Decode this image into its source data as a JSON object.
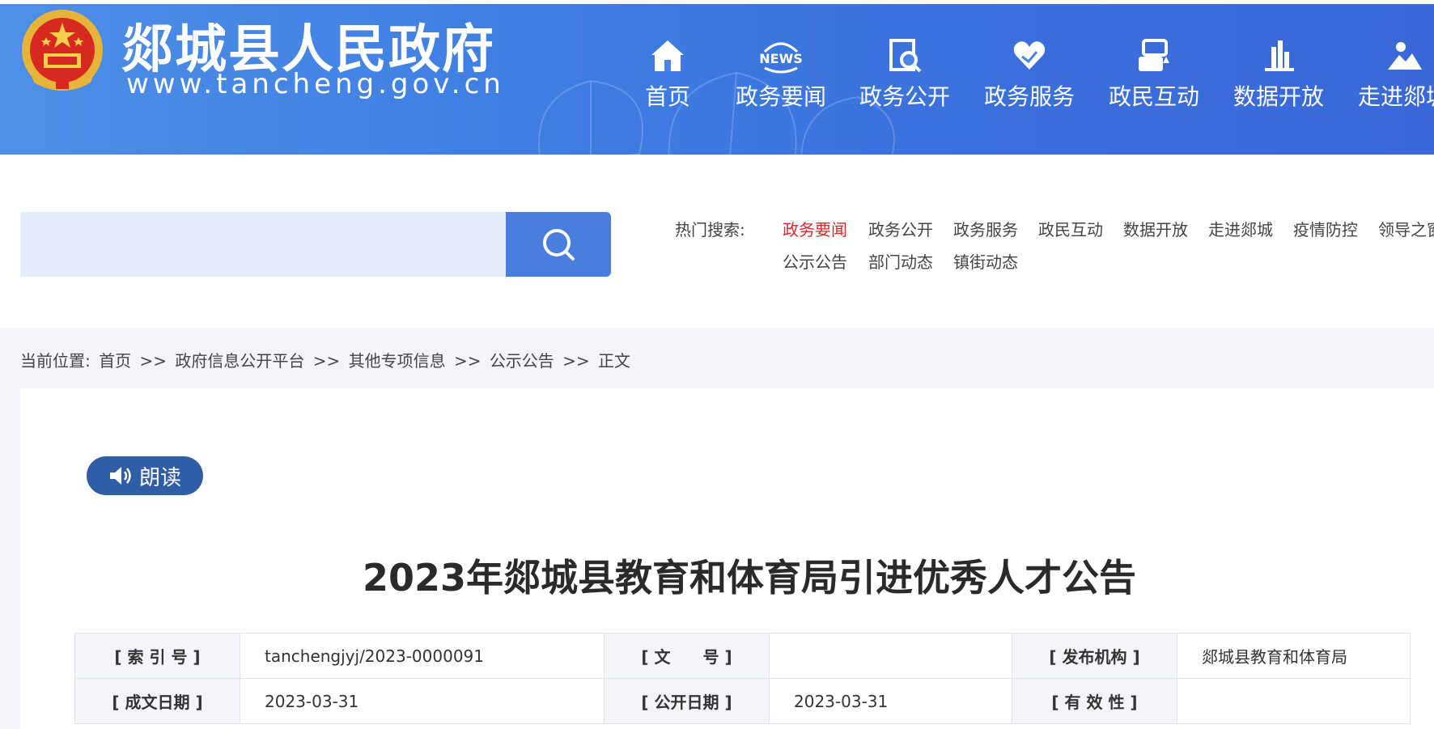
{
  "site": {
    "title": "郯城县人民政府",
    "url": "www.tancheng.gov.cn"
  },
  "nav": {
    "items": [
      {
        "label": "首页",
        "icon": "home-icon"
      },
      {
        "label": "政务要闻",
        "icon": "news-icon",
        "icon_text": "NEWS"
      },
      {
        "label": "政务公开",
        "icon": "document-search-icon"
      },
      {
        "label": "政务服务",
        "icon": "heart-hands-icon"
      },
      {
        "label": "政民互动",
        "icon": "interaction-icon"
      },
      {
        "label": "数据开放",
        "icon": "bar-chart-icon"
      },
      {
        "label": "走进郯城",
        "icon": "landscape-icon"
      }
    ]
  },
  "search": {
    "value": "",
    "placeholder": "",
    "hot_label": "热门搜索:",
    "hot_links": [
      {
        "label": "政务要闻",
        "active": true
      },
      {
        "label": "政务公开",
        "active": false
      },
      {
        "label": "政务服务",
        "active": false
      },
      {
        "label": "政民互动",
        "active": false
      },
      {
        "label": "数据开放",
        "active": false
      },
      {
        "label": "走进郯城",
        "active": false
      },
      {
        "label": "疫情防控",
        "active": false
      },
      {
        "label": "领导之窗",
        "active": false
      },
      {
        "label": "公示公告",
        "active": false
      },
      {
        "label": "部门动态",
        "active": false
      },
      {
        "label": "镇街动态",
        "active": false
      }
    ]
  },
  "breadcrumb": {
    "prefix": "当前位置:",
    "separator": ">>",
    "items": [
      "首页",
      "政府信息公开平台",
      "其他专项信息",
      "公示公告",
      "正文"
    ]
  },
  "article": {
    "read_label": "朗读",
    "title": "2023年郯城县教育和体育局引进优秀人才公告"
  },
  "meta": {
    "rows": [
      [
        {
          "key": "[ 索 引 号 ]",
          "value": "tanchengjyj/2023-0000091"
        },
        {
          "key": "[ 文　　号 ]",
          "value": ""
        },
        {
          "key": "[ 发布机构 ]",
          "value": "郯城县教育和体育局"
        }
      ],
      [
        {
          "key": "[ 成文日期 ]",
          "value": "2023-03-31"
        },
        {
          "key": "[ 公开日期 ]",
          "value": "2023-03-31"
        },
        {
          "key": "[ 有 效 性 ]",
          "value": ""
        }
      ]
    ]
  },
  "colors": {
    "header_blue": "#3f7fe3",
    "search_btn": "#4a7de0",
    "hot_active": "#d62a2a",
    "read_btn": "#2f5da6"
  }
}
